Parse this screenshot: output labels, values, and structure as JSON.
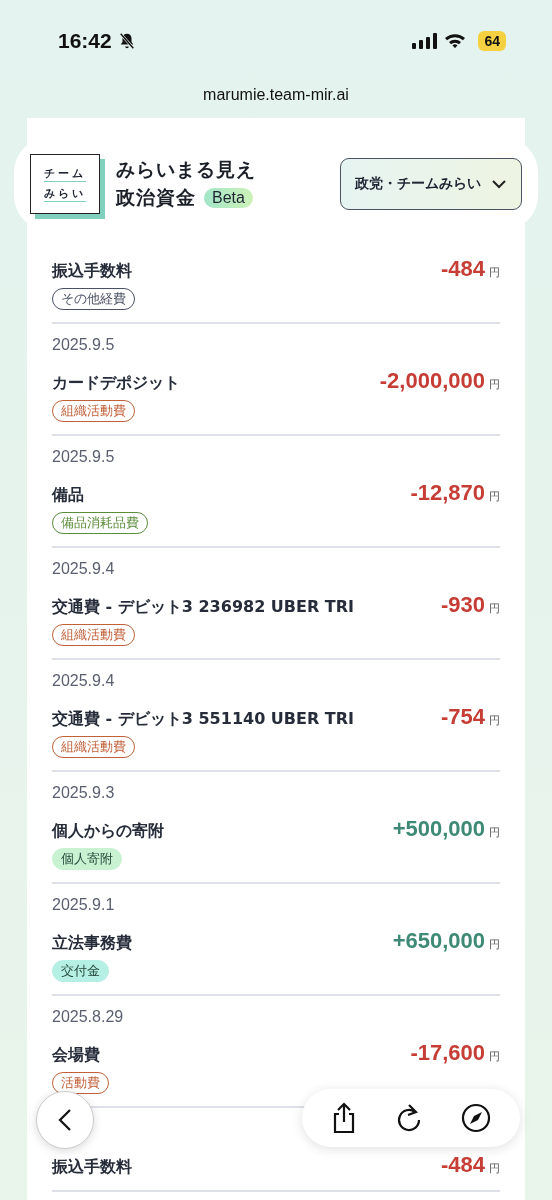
{
  "status_bar": {
    "time": "16:42",
    "battery": "64"
  },
  "browser": {
    "url": "marumie.team-mir.ai"
  },
  "header": {
    "logo_line_1": "チーム",
    "logo_line_2": "みらい",
    "title_line_1": "みらいまる見え",
    "title_line_2": "政治資金",
    "badge": "Beta",
    "org_select": "政党・チームみらい"
  },
  "transactions": [
    {
      "kind": "expense",
      "title": "振込手数料",
      "amount": "-484",
      "unit": "円",
      "tag": {
        "label": "その他経費",
        "kind": "outline",
        "color": "#4a5162"
      }
    },
    {
      "kind": "expense",
      "date": "2025.9.5",
      "title": "カードデポジット",
      "amount": "-2,000,000",
      "unit": "円",
      "tag": {
        "label": "組織活動費",
        "kind": "outline",
        "color": "#c0613a"
      }
    },
    {
      "kind": "expense",
      "date": "2025.9.5",
      "title": "備品",
      "amount": "-12,870",
      "unit": "円",
      "tag": {
        "label": "備品消耗品費",
        "kind": "outline",
        "color": "#5b8c3a"
      }
    },
    {
      "kind": "expense",
      "date": "2025.9.4",
      "title": "交通費 - デビット3 236982 UBER TRI",
      "amount": "-930",
      "unit": "円",
      "tag": {
        "label": "組織活動費",
        "kind": "outline",
        "color": "#c0613a"
      }
    },
    {
      "kind": "expense",
      "date": "2025.9.4",
      "title": "交通費 - デビット3 551140 UBER TRI",
      "amount": "-754",
      "unit": "円",
      "tag": {
        "label": "組織活動費",
        "kind": "outline",
        "color": "#c0613a"
      }
    },
    {
      "kind": "income",
      "date": "2025.9.3",
      "title": "個人からの寄附",
      "amount": "+500,000",
      "unit": "円",
      "tag": {
        "label": "個人寄附",
        "kind": "filled",
        "color": "#c8f2d2"
      }
    },
    {
      "kind": "income",
      "date": "2025.9.1",
      "title": "立法事務費",
      "amount": "+650,000",
      "unit": "円",
      "tag": {
        "label": "交付金",
        "kind": "filled",
        "color": "#b6efe4"
      }
    },
    {
      "kind": "expense",
      "date": "2025.8.29",
      "title": "会場費",
      "amount": "-17,600",
      "unit": "円",
      "tag": {
        "label": "活動費",
        "kind": "outline",
        "color": "#c0613a"
      }
    },
    {
      "kind": "expense",
      "title": "振込手数料",
      "amount": "-484",
      "unit": "円"
    }
  ]
}
